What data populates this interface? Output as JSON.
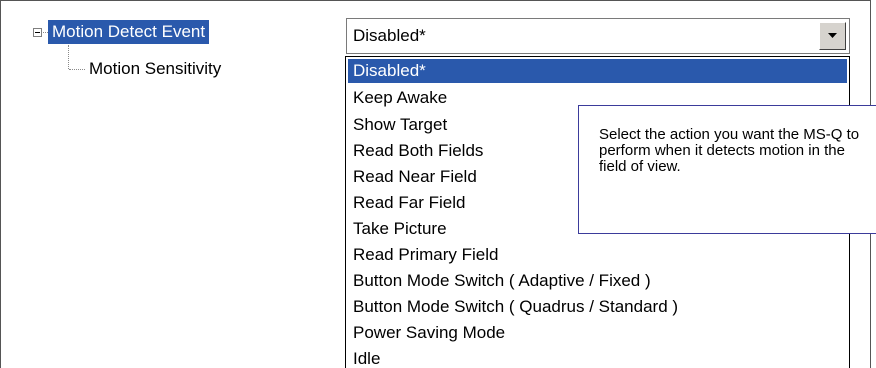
{
  "tree": {
    "parent_label": "Motion Detect Event",
    "child_label": "Motion Sensitivity"
  },
  "combo": {
    "selected_value": "Disabled*",
    "options": [
      "Disabled*",
      "Keep Awake",
      "Show Target",
      "Read Both Fields",
      "Read Near Field",
      "Read Far Field",
      "Take Picture",
      "Read Primary Field",
      "Button Mode Switch ( Adaptive / Fixed )",
      "Button Mode Switch ( Quadrus / Standard )",
      "Power Saving Mode",
      "Idle"
    ],
    "highlighted_index": 0
  },
  "help": {
    "text": "Select the action you want the MS-Q to perform when it detects motion in the field of view."
  },
  "colors": {
    "selection": "#2a59ac",
    "callout_border": "#3b3b9b"
  },
  "icons": {
    "expander": "minus-box-icon",
    "dropdown_arrow": "chevron-down-icon"
  }
}
